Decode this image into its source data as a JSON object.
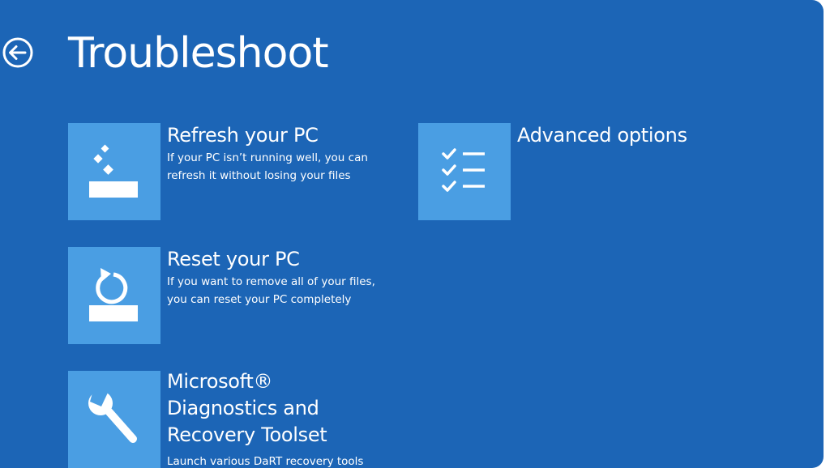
{
  "header": {
    "title": "Troubleshoot",
    "back_icon": "back-arrow-icon"
  },
  "options": {
    "refresh": {
      "title": "Refresh your PC",
      "desc_line1": "If your PC isn’t running well, you can",
      "desc_line2": "refresh it without losing your files",
      "icon": "refresh-pc-icon"
    },
    "reset": {
      "title": "Reset your PC",
      "desc_line1": "If you want to remove all of your files,",
      "desc_line2": "you can reset your PC completely",
      "icon": "reset-pc-icon"
    },
    "dart": {
      "title_line1": "Microsoft®",
      "title_line2": "Diagnostics and",
      "title_line3": "Recovery Toolset",
      "desc_line1": "Launch various DaRT recovery tools",
      "icon": "wrench-icon"
    },
    "advanced": {
      "title": "Advanced options",
      "icon": "checklist-icon"
    }
  },
  "colors": {
    "background": "#1c65b6",
    "tile": "#4a9ee3",
    "text": "#ffffff"
  }
}
